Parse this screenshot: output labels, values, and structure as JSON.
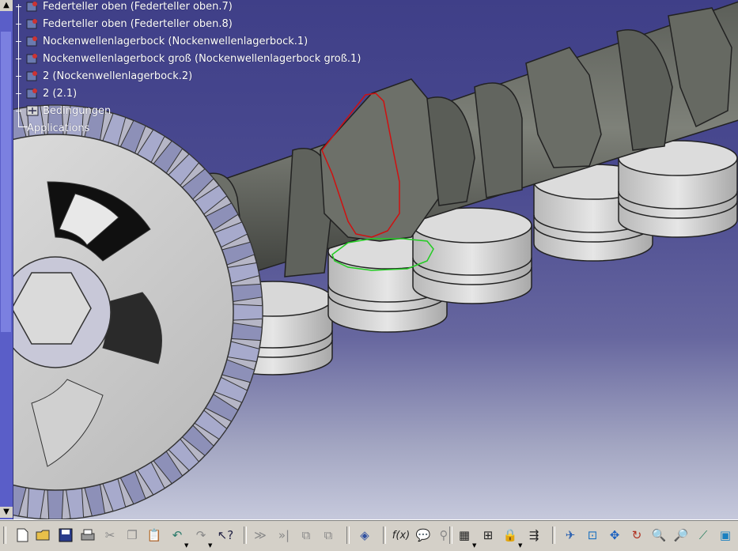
{
  "tree": {
    "items": [
      {
        "label": "Federteller oben (Federteller oben.7)",
        "icon": "part-icon"
      },
      {
        "label": "Federteller oben (Federteller oben.8)",
        "icon": "part-icon"
      },
      {
        "label": "Nockenwellenlagerbock (Nockenwellenlagerbock.1)",
        "icon": "part-icon"
      },
      {
        "label": "Nockenwellenlagerbock groß (Nockenwellenlagerbock groß.1)",
        "icon": "part-icon"
      },
      {
        "label": "2 (Nockenwellenlagerbock.2)",
        "icon": "part-icon"
      },
      {
        "label": "2 (2.1)",
        "icon": "part-icon"
      },
      {
        "label": "Bedingungen",
        "icon": "constraints-icon"
      },
      {
        "label": "Applications",
        "icon": ""
      }
    ],
    "text_color": "#ffffff"
  },
  "viewport": {
    "background_top": "#3f3f88",
    "background_bottom": "#c6c9dc",
    "highlight_red": "#d01010",
    "highlight_green": "#22cc22"
  },
  "toolbar": {
    "buttons": [
      "new-icon",
      "open-icon",
      "save-icon",
      "print-icon",
      "cut-icon",
      "copy-icon",
      "paste-icon",
      "undo-icon",
      "redo-icon",
      "whats-this-icon",
      "fast-multi-instantiation-icon",
      "multi-instantiation-icon",
      "catalog-icon",
      "catalog-browser-icon",
      "measure-icon",
      "formula-icon",
      "comment-icon",
      "link-icon",
      "table-icon",
      "tree-expand-icon",
      "lock-icon",
      "publish-icon",
      "fly-mode-icon",
      "fit-all-icon",
      "pan-icon",
      "rotate-icon",
      "zoom-in-icon",
      "zoom-out-icon",
      "normal-view-icon",
      "views-icon"
    ],
    "labels": {
      "formula": "f(x)"
    }
  }
}
